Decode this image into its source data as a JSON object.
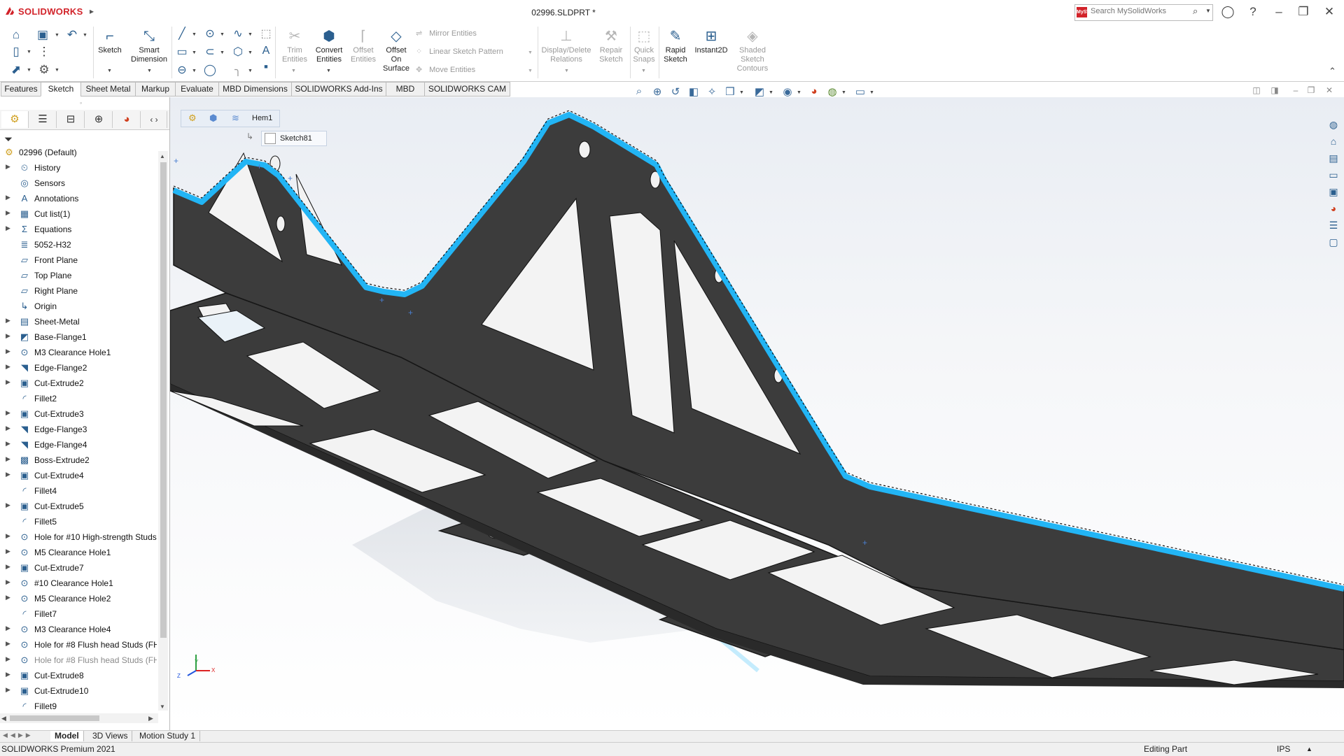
{
  "app": {
    "brand": "SOLIDWORKS",
    "document_title": "02996.SLDPRT *"
  },
  "search": {
    "placeholder": "Search MySolidWorks",
    "logo": "MySW"
  },
  "colors": {
    "brand_red": "#d2232a",
    "accent_blue": "#2b5f8f",
    "highlight_cyan": "#22b5f5",
    "part_dark": "#3a3a3a"
  },
  "command_manager": {
    "sketch": "Sketch",
    "smart_dimension": [
      "Smart",
      "Dimension"
    ],
    "trim_entities": [
      "Trim",
      "Entities"
    ],
    "convert_entities": [
      "Convert",
      "Entities"
    ],
    "offset_entities": [
      "Offset",
      "Entities"
    ],
    "offset_on_surface": [
      "Offset",
      "On",
      "Surface"
    ],
    "mirror_entities": "Mirror Entities",
    "linear_sketch_pattern": "Linear Sketch Pattern",
    "move_entities": "Move Entities",
    "display_delete_relations": [
      "Display/Delete",
      "Relations"
    ],
    "repair_sketch": [
      "Repair",
      "Sketch"
    ],
    "quick_snaps": [
      "Quick",
      "Snaps"
    ],
    "rapid_sketch": [
      "Rapid",
      "Sketch"
    ],
    "instant2d": "Instant2D",
    "shaded_sketch_contours": [
      "Shaded",
      "Sketch",
      "Contours"
    ]
  },
  "tabs": [
    "Features",
    "Sketch",
    "Sheet Metal",
    "Markup",
    "Evaluate",
    "MBD Dimensions",
    "SOLIDWORKS Add-Ins",
    "MBD",
    "SOLIDWORKS CAM"
  ],
  "active_tab": "Sketch",
  "breadcrumb": {
    "feature": "Hem1",
    "sketch": "Sketch81"
  },
  "tree": {
    "root": "02996  (Default)",
    "items": [
      {
        "label": "History",
        "icon": "history-icon",
        "expandable": true
      },
      {
        "label": "Sensors",
        "icon": "sensors-icon",
        "expandable": false
      },
      {
        "label": "Annotations",
        "icon": "annotations-icon",
        "expandable": true
      },
      {
        "label": "Cut list(1)",
        "icon": "cut-list-icon",
        "expandable": true
      },
      {
        "label": "Equations",
        "icon": "equations-icon",
        "expandable": true
      },
      {
        "label": "5052-H32",
        "icon": "material-icon",
        "expandable": false
      },
      {
        "label": "Front Plane",
        "icon": "plane-icon",
        "expandable": false
      },
      {
        "label": "Top Plane",
        "icon": "plane-icon",
        "expandable": false
      },
      {
        "label": "Right Plane",
        "icon": "plane-icon",
        "expandable": false
      },
      {
        "label": "Origin",
        "icon": "origin-icon",
        "expandable": false
      },
      {
        "label": "Sheet-Metal",
        "icon": "sheet-metal-icon",
        "expandable": true
      },
      {
        "label": "Base-Flange1",
        "icon": "base-flange-icon",
        "expandable": true
      },
      {
        "label": "M3 Clearance Hole1",
        "icon": "hole-wizard-icon",
        "expandable": true
      },
      {
        "label": "Edge-Flange2",
        "icon": "edge-flange-icon",
        "expandable": true
      },
      {
        "label": "Cut-Extrude2",
        "icon": "cut-extrude-icon",
        "expandable": true
      },
      {
        "label": "Fillet2",
        "icon": "fillet-icon",
        "expandable": false
      },
      {
        "label": "Cut-Extrude3",
        "icon": "cut-extrude-icon",
        "expandable": true
      },
      {
        "label": "Edge-Flange3",
        "icon": "edge-flange-icon",
        "expandable": true
      },
      {
        "label": "Edge-Flange4",
        "icon": "edge-flange-icon",
        "expandable": true
      },
      {
        "label": "Boss-Extrude2",
        "icon": "boss-extrude-icon",
        "expandable": true
      },
      {
        "label": "Cut-Extrude4",
        "icon": "cut-extrude-icon",
        "expandable": true
      },
      {
        "label": "Fillet4",
        "icon": "fillet-icon",
        "expandable": false
      },
      {
        "label": "Cut-Extrude5",
        "icon": "cut-extrude-icon",
        "expandable": true
      },
      {
        "label": "Fillet5",
        "icon": "fillet-icon",
        "expandable": false
      },
      {
        "label": "Hole for #10 High-strength Studs",
        "icon": "hole-wizard-icon",
        "expandable": true
      },
      {
        "label": "M5 Clearance Hole1",
        "icon": "hole-wizard-icon",
        "expandable": true
      },
      {
        "label": "Cut-Extrude7",
        "icon": "cut-extrude-icon",
        "expandable": true
      },
      {
        "label": "#10 Clearance Hole1",
        "icon": "hole-wizard-icon",
        "expandable": true
      },
      {
        "label": "M5 Clearance Hole2",
        "icon": "hole-wizard-icon",
        "expandable": true
      },
      {
        "label": "Fillet7",
        "icon": "fillet-icon",
        "expandable": false
      },
      {
        "label": "M3 Clearance Hole4",
        "icon": "hole-wizard-icon",
        "expandable": true
      },
      {
        "label": "Hole for #8 Flush head Studs (FH,",
        "icon": "hole-wizard-icon",
        "expandable": true
      },
      {
        "label": "Hole for #8 Flush head Studs (FH,",
        "icon": "hole-wizard-icon",
        "expandable": true,
        "dim": true
      },
      {
        "label": "Cut-Extrude8",
        "icon": "cut-extrude-icon",
        "expandable": true
      },
      {
        "label": "Cut-Extrude10",
        "icon": "cut-extrude-icon",
        "expandable": true
      },
      {
        "label": "Fillet9",
        "icon": "fillet-icon",
        "expandable": false
      }
    ]
  },
  "bottom_tabs": [
    "Model",
    "3D Views",
    "Motion Study 1"
  ],
  "active_bottom_tab": "Model",
  "status": {
    "product": "SOLIDWORKS Premium 2021",
    "mode": "Editing Part",
    "units": "IPS"
  },
  "triad": {
    "x": "X",
    "y": "Y",
    "z": "Z"
  }
}
